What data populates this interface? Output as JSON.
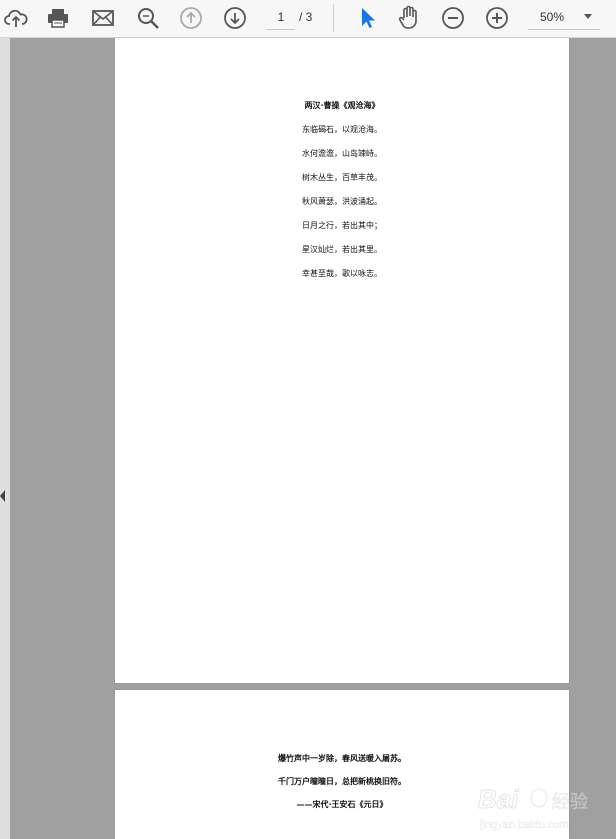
{
  "toolbar": {
    "page_current": "1",
    "page_total": "/ 3",
    "zoom": "50%",
    "icons": [
      "upload-icon",
      "print-icon",
      "email-icon",
      "search-icon",
      "page-up-icon",
      "page-down-icon",
      "select-cursor-icon",
      "hand-icon",
      "zoom-out-icon",
      "zoom-in-icon",
      "chevron-down-icon"
    ],
    "accent_color": "#1a73e8"
  },
  "page1": {
    "title": "两汉·曹操《观沧海》",
    "lines": [
      "东临碣石，以观沧海。",
      "水何澹澹，山岛竦峙。",
      "树木丛生，百草丰茂。",
      "秋风萧瑟，洪波涌起。",
      "日月之行，若出其中；",
      "星汉灿烂，若出其里。",
      "幸甚至哉，歌以咏志。"
    ]
  },
  "page2": {
    "lines": [
      "爆竹声中一岁除，春风送暖入屠苏。",
      "千门万户曈曈日，总把新桃换旧符。",
      "——宋代·王安石《元日》"
    ]
  },
  "watermark": {
    "brand": "Bai",
    "brand_suffix": "经验",
    "url": "jingyan.baidu.com"
  }
}
